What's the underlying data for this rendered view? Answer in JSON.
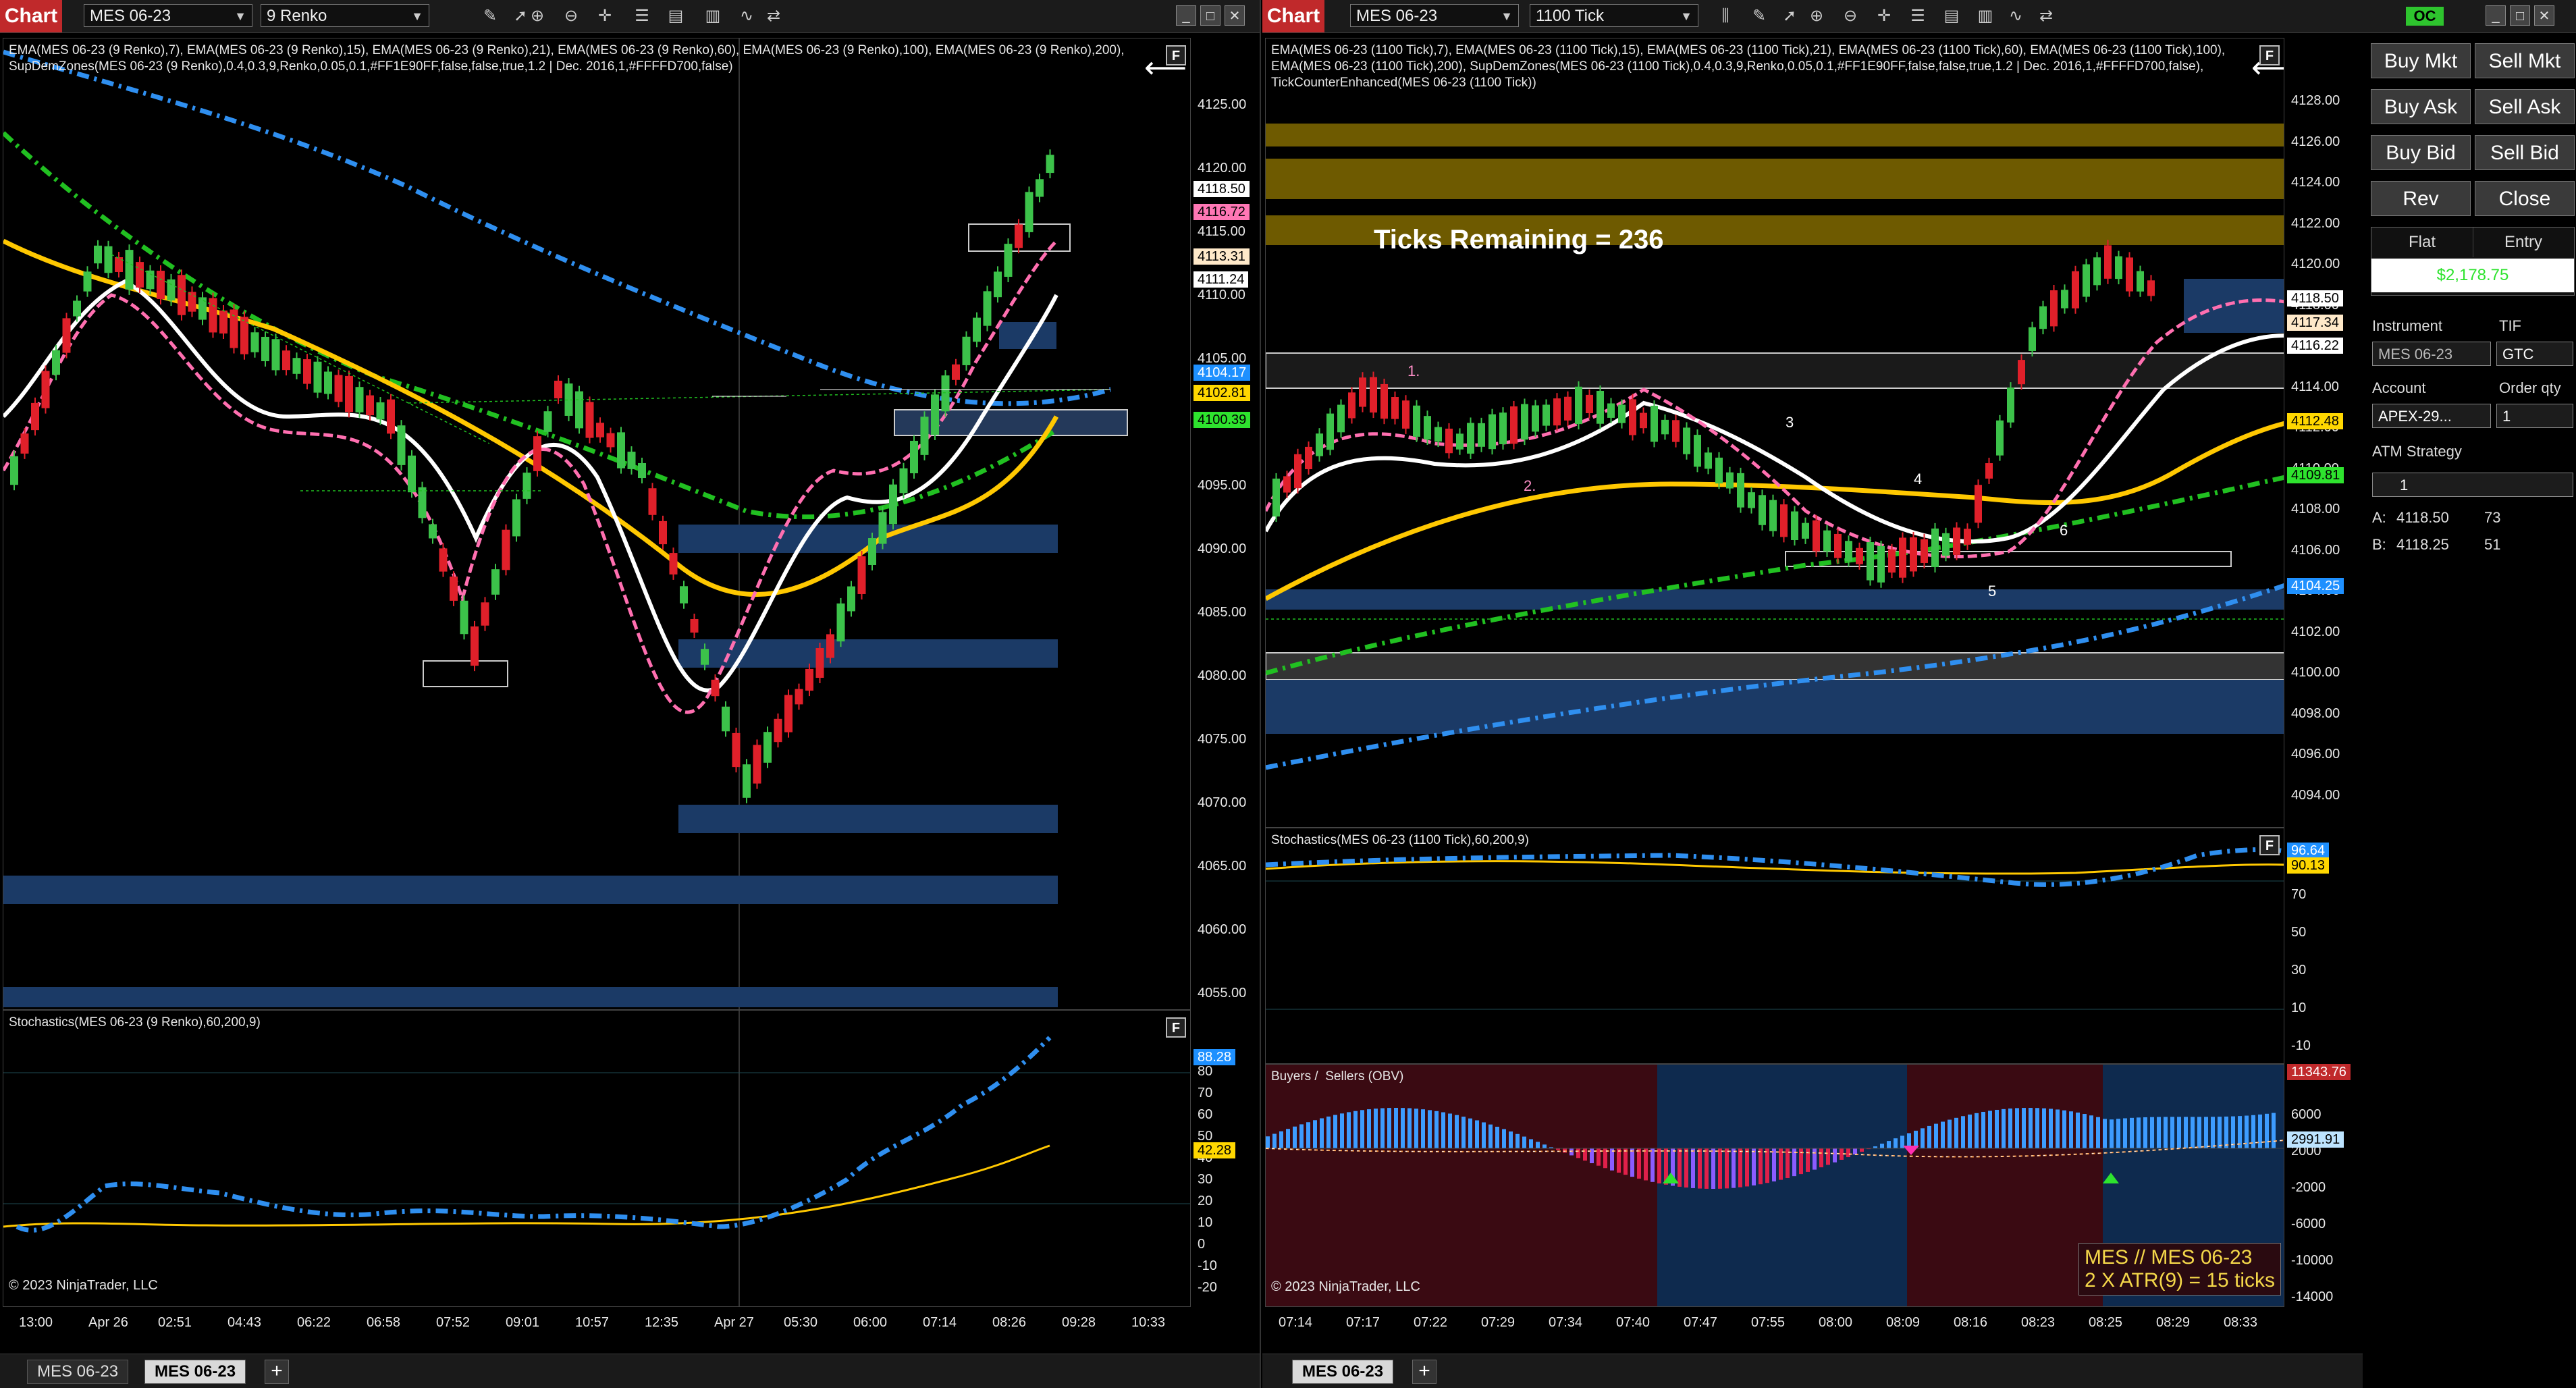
{
  "left": {
    "title": "Chart",
    "instrument": "MES 06-23",
    "bartype": "9 Renko",
    "legend": "EMA(MES 06-23 (9 Renko),7), EMA(MES 06-23 (9 Renko),15), EMA(MES 06-23 (9 Renko),21), EMA(MES 06-23 (9 Renko),60), EMA(MES 06-23 (9 Renko),100), EMA(MES 06-23 (9 Renko),200), SupDemZones(MES 06-23 (9 Renko),0.4,0.3,9,Renko,0.05,0.1,#FF1E90FF,false,false,true,1.2 | Dec. 2016,1,#FFFFD700,false)",
    "price_ticks": [
      "4125.00",
      "4120.00",
      "4115.00",
      "4110.00",
      "4105.00",
      "4100.00",
      "4095.00",
      "4090.00",
      "4085.00",
      "4080.00",
      "4075.00",
      "4070.00",
      "4065.00",
      "4060.00",
      "4055.00"
    ],
    "price_labels": [
      {
        "text": "4118.50",
        "color": "#000000",
        "bg": "#ffffff"
      },
      {
        "text": "4116.72",
        "color": "#000000",
        "bg": "#ff77b5"
      },
      {
        "text": "4113.31",
        "color": "#000000",
        "bg": "#ffe9c9"
      },
      {
        "text": "4111.24",
        "color": "#000000",
        "bg": "#ffffff"
      },
      {
        "text": "4104.17",
        "color": "#ffffff",
        "bg": "#1e90ff"
      },
      {
        "text": "4102.81",
        "color": "#000000",
        "bg": "#ffd700"
      },
      {
        "text": "4100.39",
        "color": "#000000",
        "bg": "#2ee32e"
      }
    ],
    "stoch_title": "Stochastics(MES 06-23 (9 Renko),60,200,9)",
    "stoch_ticks": [
      "80",
      "70",
      "60",
      "50",
      "40",
      "30",
      "20",
      "10",
      "0",
      "-10",
      "-20"
    ],
    "stoch_labels": [
      {
        "text": "88.28",
        "color": "#ffffff",
        "bg": "#1e90ff"
      },
      {
        "text": "42.28",
        "color": "#000000",
        "bg": "#ffd700"
      }
    ],
    "copyright": "© 2023 NinjaTrader, LLC",
    "x_ticks": [
      "13:00",
      "Apr 26",
      "02:51",
      "04:43",
      "06:22",
      "06:58",
      "07:52",
      "09:01",
      "10:57",
      "12:35",
      "Apr 27",
      "05:30",
      "06:00",
      "07:14",
      "08:26",
      "09:28",
      "10:33"
    ],
    "tabs": [
      "MES 06-23",
      "MES 06-23"
    ],
    "window_buttons": [
      "_",
      "□",
      "✕"
    ]
  },
  "right": {
    "title": "Chart",
    "instrument": "MES 06-23",
    "bartype": "1100 Tick",
    "legend": "EMA(MES 06-23 (1100 Tick),7), EMA(MES 06-23 (1100 Tick),15), EMA(MES 06-23 (1100 Tick),21), EMA(MES 06-23 (1100 Tick),60), EMA(MES 06-23 (1100 Tick),100), EMA(MES 06-23 (1100 Tick),200), SupDemZones(MES 06-23 (1100 Tick),0.4,0.3,9,Renko,0.05,0.1,#FF1E90FF,false,false,true,1.2 | Dec. 2016,1,#FFFFD700,false), TickCounterEnhanced(MES 06-23 (1100 Tick))",
    "ticks_remaining": "Ticks Remaining = 236",
    "price_ticks": [
      "4128.00",
      "4126.00",
      "4124.00",
      "4122.00",
      "4120.00",
      "4118.00",
      "4116.00",
      "4114.00",
      "4112.00",
      "4110.00",
      "4108.00",
      "4106.00",
      "4104.00",
      "4102.00",
      "4100.00",
      "4098.00",
      "4096.00",
      "4094.00"
    ],
    "price_labels": [
      {
        "text": "4118.50",
        "color": "#000000",
        "bg": "#ffffff"
      },
      {
        "text": "4117.34",
        "color": "#000000",
        "bg": "#ffe9c9"
      },
      {
        "text": "4116.22",
        "color": "#000000",
        "bg": "#ffffff"
      },
      {
        "text": "4112.48",
        "color": "#000000",
        "bg": "#ffd700"
      },
      {
        "text": "4109.81",
        "color": "#000000",
        "bg": "#2ee32e"
      },
      {
        "text": "4104.25",
        "color": "#ffffff",
        "bg": "#1e90ff"
      }
    ],
    "wave_labels": [
      "1.",
      "2.",
      "3",
      "4",
      "5",
      "6"
    ],
    "stoch_title": "Stochastics(MES 06-23 (1100 Tick),60,200,9)",
    "stoch_ticks": [
      "70",
      "50",
      "30",
      "10",
      "-10"
    ],
    "stoch_labels": [
      {
        "text": "96.64",
        "color": "#ffffff",
        "bg": "#1e90ff"
      },
      {
        "text": "90.13",
        "color": "#000000",
        "bg": "#ffd700"
      }
    ],
    "obv_title": "Buyers /  Sellers (OBV)",
    "obv_ticks": [
      "6000",
      "2000",
      "-2000",
      "-6000",
      "-10000",
      "-14000"
    ],
    "obv_labels": [
      {
        "text": "11343.76",
        "color": "#ffffff",
        "bg": "#c0292b"
      },
      {
        "text": "2991.91",
        "color": "#000000",
        "bg": "#bde4ff"
      }
    ],
    "atr_line1": "MES // MES 06-23",
    "atr_line2": "2 X ATR(9) = 15 ticks",
    "copyright": "© 2023 NinjaTrader, LLC",
    "x_ticks": [
      "07:14",
      "07:17",
      "07:22",
      "07:29",
      "07:34",
      "07:40",
      "07:47",
      "07:55",
      "08:00",
      "08:09",
      "08:16",
      "08:23",
      "08:25",
      "08:29",
      "08:33"
    ],
    "tabs": [
      "MES 06-23"
    ],
    "oc": "OC",
    "window_buttons": [
      "_",
      "□",
      "✕"
    ]
  },
  "control_panel": {
    "buttons": [
      "Buy Mkt",
      "Sell Mkt",
      "Buy Ask",
      "Sell Ask",
      "Buy Bid",
      "Sell Bid",
      "Rev",
      "Close"
    ],
    "position": "Flat",
    "entry": "Entry",
    "pnl": "$2,178.75",
    "instrument_label": "Instrument",
    "tif_label": "TIF",
    "instrument_value": "MES 06-23",
    "tif_value": "GTC",
    "account_label": "Account",
    "qty_label": "Order qty",
    "account_value": "APEX-29...",
    "qty_value": "1",
    "atm_label": "ATM Strategy",
    "atm_value": "1",
    "ask_label": "A:",
    "ask_price": "4118.50",
    "ask_size": "73",
    "bid_label": "B:",
    "bid_price": "4118.25",
    "bid_size": "51",
    "colors": {
      "pnl": "#2ee32e",
      "button_bg": "#3a3a3a"
    }
  },
  "colors": {
    "up_candle": "#3cc24a",
    "down_candle": "#e0202a",
    "zone_blue": "#1b3a66",
    "zone_gold": "#6e5a00",
    "ema200_blue": "#2f8ff0",
    "ema100_green": "#21c021",
    "ema60_gold": "#ffc800",
    "ema_pink": "#ff6fb0",
    "ema_white": "#ffffff"
  }
}
